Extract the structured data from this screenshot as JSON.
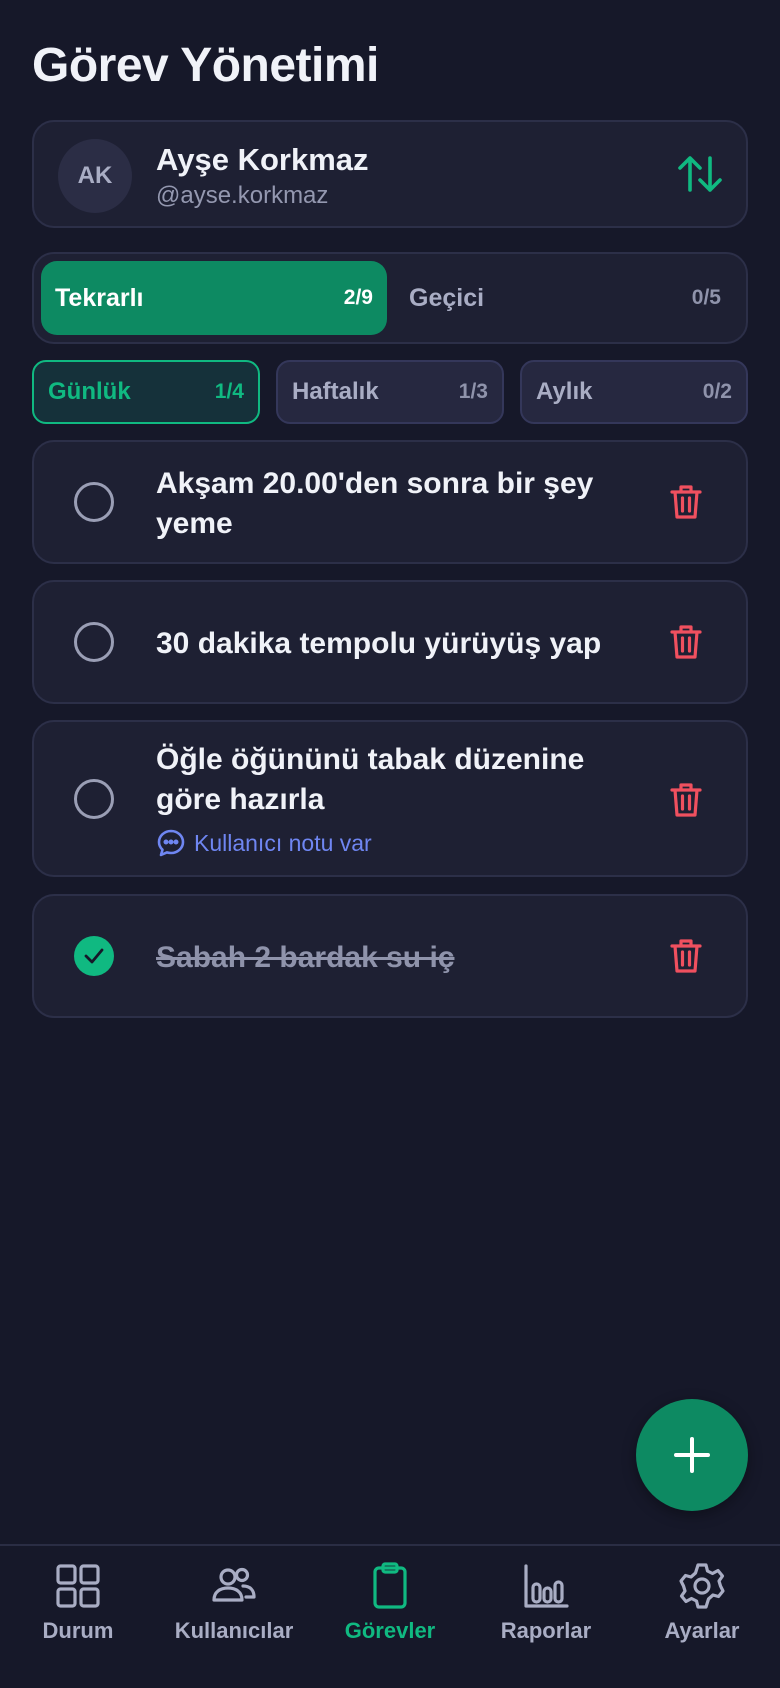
{
  "page_title": "Görev Yönetimi",
  "user": {
    "initials": "AK",
    "name": "Ayşe Korkmaz",
    "handle": "@ayse.korkmaz"
  },
  "type_tabs": [
    {
      "label": "Tekrarlı",
      "count": "2/9",
      "active": true
    },
    {
      "label": "Geçici",
      "count": "0/5",
      "active": false
    }
  ],
  "period_tabs": [
    {
      "label": "Günlük",
      "count": "1/4",
      "active": true
    },
    {
      "label": "Haftalık",
      "count": "1/3",
      "active": false
    },
    {
      "label": "Aylık",
      "count": "0/2",
      "active": false
    }
  ],
  "tasks": [
    {
      "text": "Akşam 20.00'den sonra bir şey yeme",
      "done": false
    },
    {
      "text": "30 dakika tempolu yürüyüş yap",
      "done": false
    },
    {
      "text": "Öğle öğününü tabak düzenine göre hazırla",
      "done": false,
      "note": "Kullanıcı notu var"
    },
    {
      "text": "Sabah 2 bardak su iç",
      "done": true
    }
  ],
  "nav": [
    {
      "label": "Durum",
      "icon": "grid-icon",
      "active": false
    },
    {
      "label": "Kullanıcılar",
      "icon": "users-icon",
      "active": false
    },
    {
      "label": "Görevler",
      "icon": "clipboard-icon",
      "active": true
    },
    {
      "label": "Raporlar",
      "icon": "bar-chart-icon",
      "active": false
    },
    {
      "label": "Ayarlar",
      "icon": "gear-icon",
      "active": false
    }
  ],
  "colors": {
    "background": "#161829",
    "card": "#1e2033",
    "accent": "#0d8a62",
    "accent_bright": "#10b981",
    "danger": "#f0505f",
    "note": "#6f86f2"
  }
}
